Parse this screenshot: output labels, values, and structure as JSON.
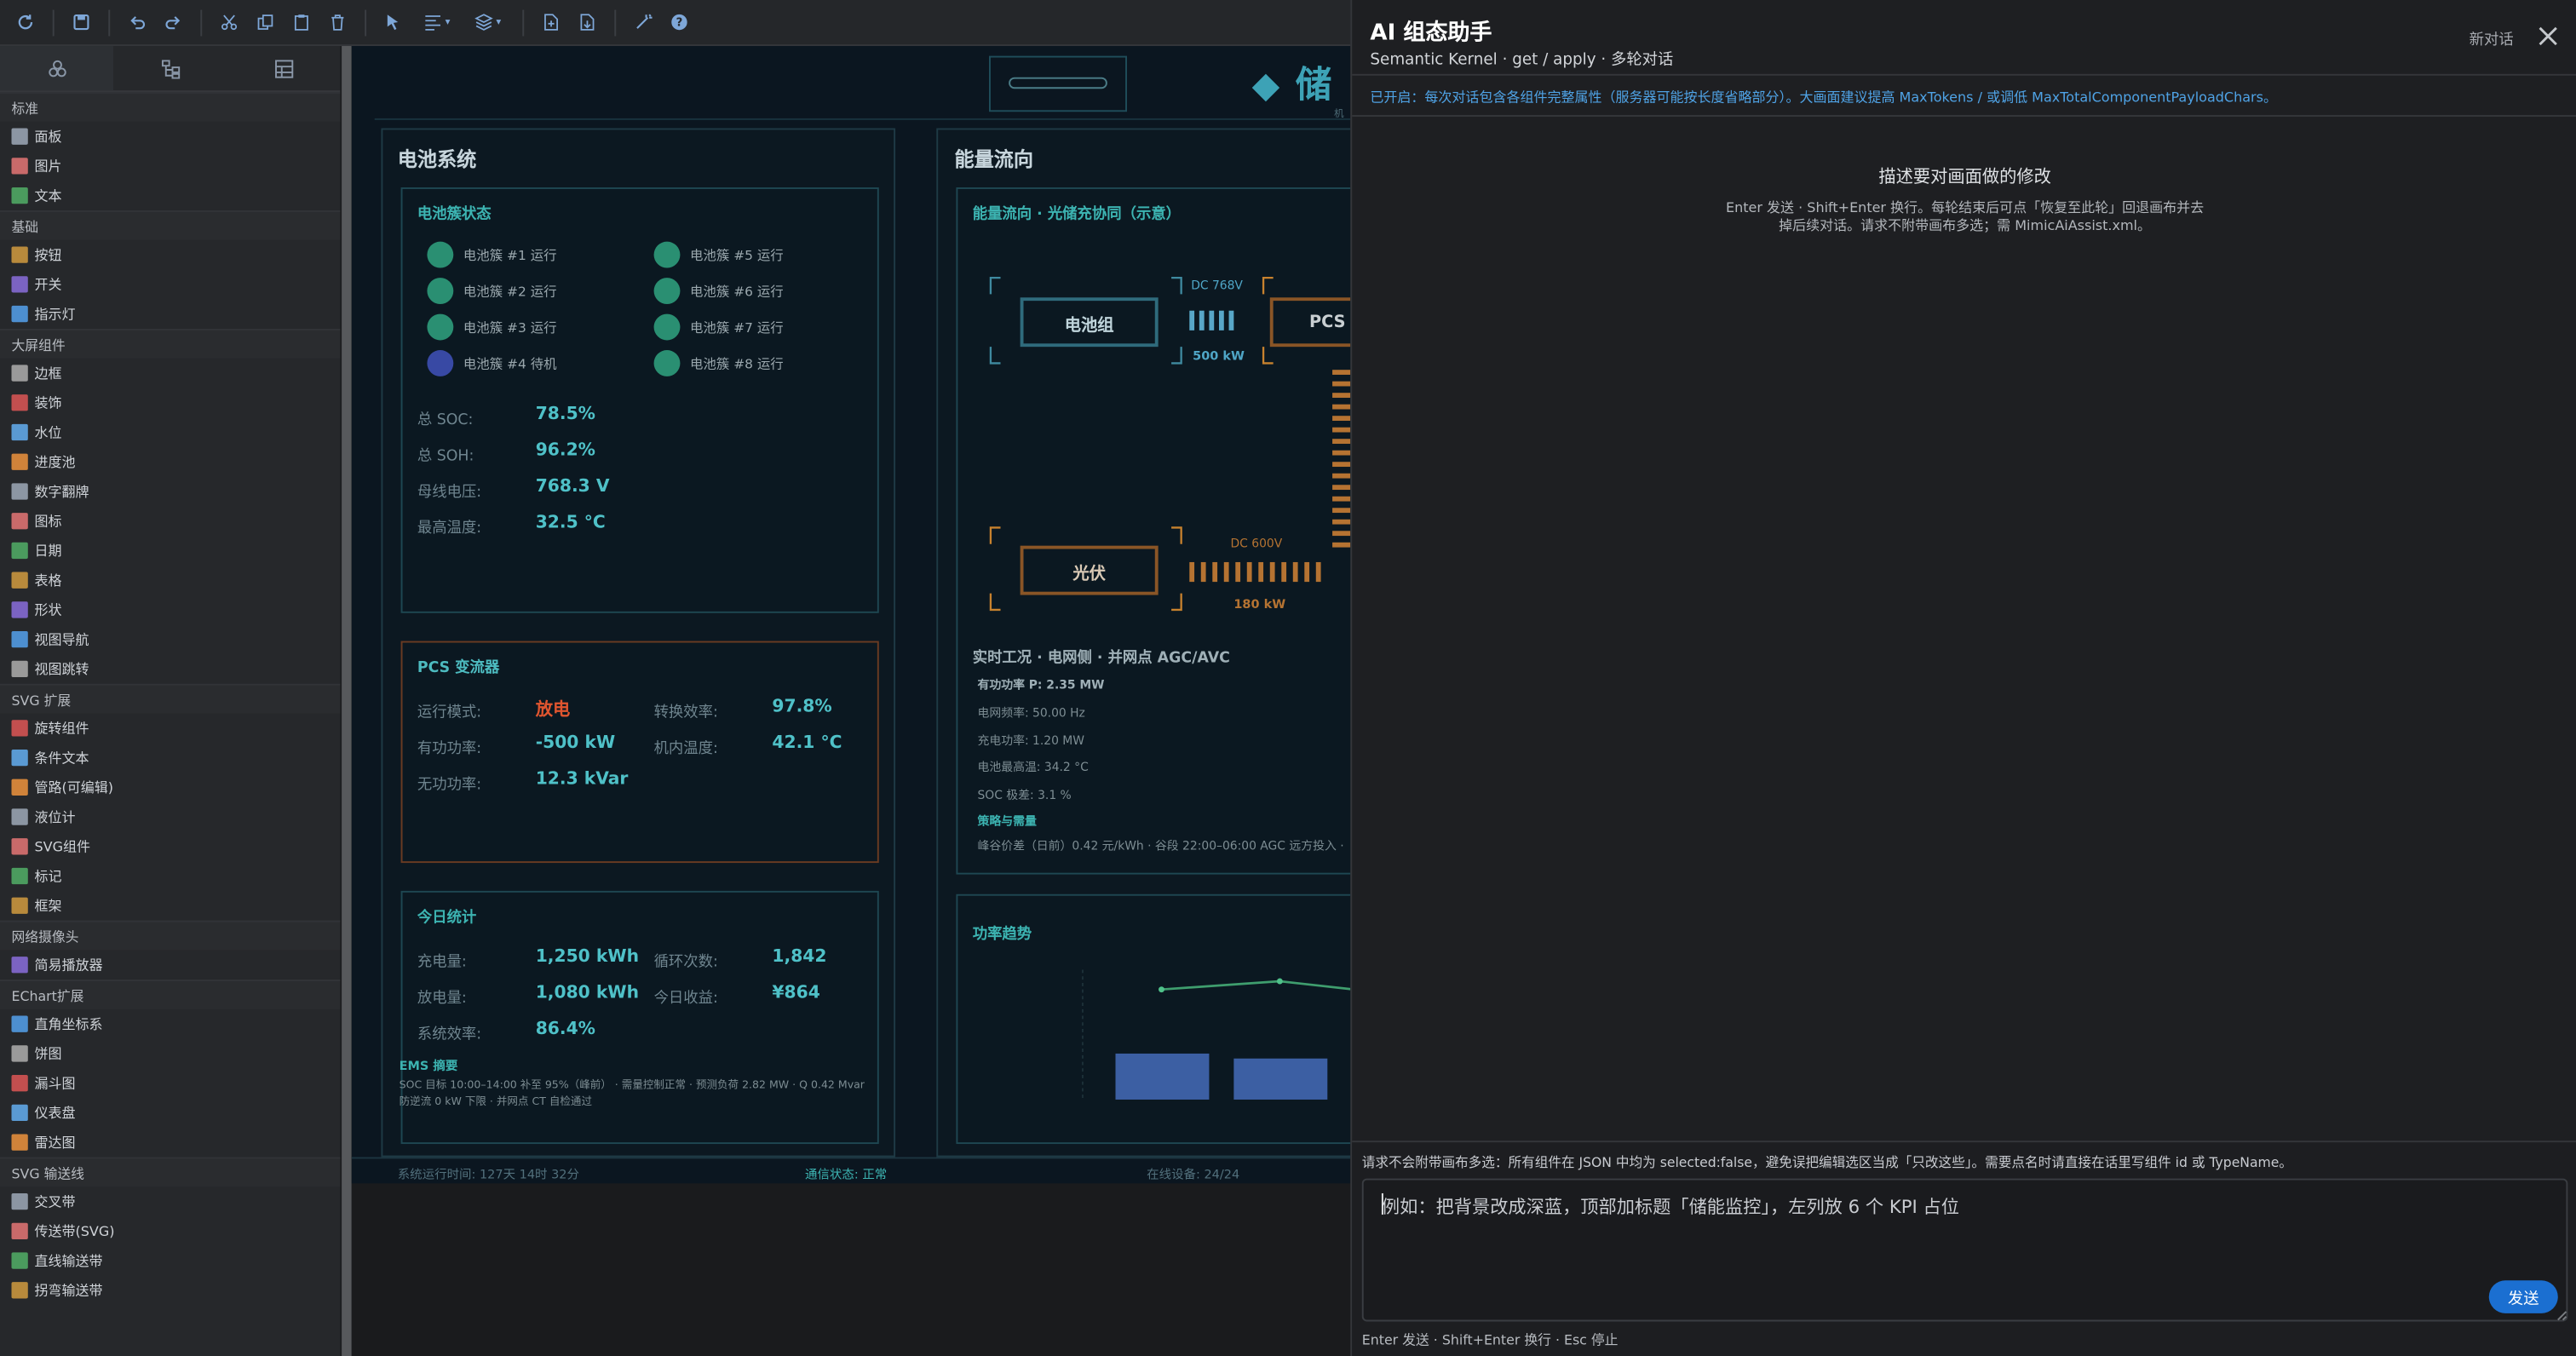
{
  "toolbar": {
    "icons": [
      "refresh-icon",
      "save-icon",
      "undo-icon",
      "redo-icon",
      "cut-icon",
      "copy-icon",
      "paste-icon",
      "delete-icon",
      "select-icon",
      "align-icon",
      "layer-icon",
      "export-icon",
      "import-icon",
      "magic-icon",
      "help-icon"
    ]
  },
  "left": {
    "tabs": [
      "components-icon",
      "tree-icon",
      "grid-icon"
    ],
    "groups": [
      {
        "title": "标准",
        "items": [
          "面板",
          "图片",
          "文本"
        ]
      },
      {
        "title": "基础",
        "items": [
          "按钮",
          "开关",
          "指示灯"
        ]
      },
      {
        "title": "大屏组件",
        "items": [
          "边框",
          "装饰",
          "水位",
          "进度池",
          "数字翻牌",
          "图标",
          "日期",
          "表格",
          "形状",
          "视图导航",
          "视图跳转"
        ]
      },
      {
        "title": "SVG 扩展",
        "items": [
          "旋转组件",
          "条件文本",
          "管路(可编辑)",
          "液位计",
          "SVG组件",
          "标记",
          "框架"
        ]
      },
      {
        "title": "网络摄像头",
        "items": [
          "简易播放器"
        ]
      },
      {
        "title": "EChart扩展",
        "items": [
          "直角坐标系",
          "饼图",
          "漏斗图",
          "仪表盘",
          "雷达图"
        ]
      },
      {
        "title": "SVG 输送线",
        "items": [
          "交叉带",
          "传送带(SVG)",
          "直线输送带",
          "拐弯输送带"
        ]
      }
    ]
  },
  "canvas": {
    "header_title": "◆ 储",
    "header_sub": "机",
    "battery": {
      "section": "电池系统",
      "cluster_title": "电池簇状态",
      "clusters": [
        "电池簇 #1 运行",
        "电池簇 #2 运行",
        "电池簇 #3 运行",
        "电池簇 #4 待机",
        "电池簇 #5 运行",
        "电池簇 #6 运行",
        "电池簇 #7 运行",
        "电池簇 #8 运行"
      ],
      "soc_label": "总 SOC:",
      "soc": "78.5%",
      "soh_label": "总 SOH:",
      "soh": "96.2%",
      "bus_label": "母线电压:",
      "bus": "768.3 V",
      "temp_label": "最高温度:",
      "temp": "32.5 °C",
      "pcs_title": "PCS 变流器",
      "mode_label": "运行模式:",
      "mode": "放电",
      "eff_label": "转换效率:",
      "eff": "97.8%",
      "p_label": "有功功率:",
      "p": "-500 kW",
      "cab_label": "机内温度:",
      "cab": "42.1 °C",
      "q_label": "无功功率:",
      "q": "12.3 kVar",
      "today_title": "今日统计",
      "chg_label": "充电量:",
      "chg": "1,250 kWh",
      "cyc_label": "循环次数:",
      "cyc": "1,842",
      "dis_label": "放电量:",
      "dis": "1,080 kWh",
      "rev_label": "今日收益:",
      "rev": "¥864",
      "seff_label": "系统效率:",
      "seff": "86.4%",
      "ems_title": "EMS 摘要",
      "ems_line1": "SOC 目标 10:00–14:00 补至 95%（峰前） · 需量控制正常 · 预测负荷 2.82 MW · Q 0.42 Mvar",
      "ems_line2": "防逆流 0 kW 下限 · 并网点 CT 自检通过"
    },
    "energy": {
      "section": "能量流向",
      "flow_title": "能量流向 · 光储充协同（示意）",
      "battery_box": "电池组",
      "dc768": "DC 768V",
      "kw500": "500 kW",
      "pcs_box": "PCS",
      "pv_box": "光伏",
      "dc600": "DC 600V",
      "kw180": "180 kW",
      "grid_title": "实时工况 · 电网侧 · 并网点 AGC/AVC",
      "grid_p": "有功功率 P:  2.35 MW",
      "grid_f": "电网频率:  50.00 Hz",
      "grid_c": "充电功率:  1.20 MW",
      "grid_t": "电池最高温:  34.2 °C",
      "grid_soc": "SOC 极差:  3.1 %",
      "strategy_title": "策略与需量",
      "strategy_line": "峰谷价差（日前）0.42 元/kWh · 谷段 22:00–06:00 AGC 远方投入 ·",
      "trend_title": "功率趋势"
    },
    "status": {
      "uptime": "系统运行时间: 127天 14时 32分",
      "comm": "通信状态: 正常",
      "online": "在线设备: 24/24"
    }
  },
  "ai": {
    "title": "AI 组态助手",
    "subtitle": "Semantic Kernel · get / apply · 多轮对话",
    "new_chat": "新对话",
    "info": "已开启：每次对话包含各组件完整属性（服务器可能按长度省略部分）。大画面建议提高 MaxTokens / 或调低 MaxTotalComponentPayloadChars。",
    "hint_title": "描述要对画面做的修改",
    "hint_line1": "Enter 发送 · Shift+Enter 换行。每轮结束后可点「恢复至此轮」回退画布并去",
    "hint_line2": "掉后续对话。请求不附带画布多选；需 MimicAiAssist.xml。",
    "warn": "请求不会附带画布多选：所有组件在 JSON 中均为 selected:false，避免误把编辑选区当成「只改这些」。需要点名时请直接在话里写组件 id 或 TypeName。",
    "placeholder": "例如：把背景改成深蓝，顶部加标题「储能监控」，左列放 6 个 KPI 占位",
    "send": "发送",
    "keys": "Enter 发送 · Shift+Enter 换行 · Esc 停止"
  },
  "colors": {
    "accent": "#1b6fd1",
    "info": "#4fa3e6",
    "teal": "#4fc1c8",
    "red": "#e0552f",
    "orange": "#c8822e"
  }
}
